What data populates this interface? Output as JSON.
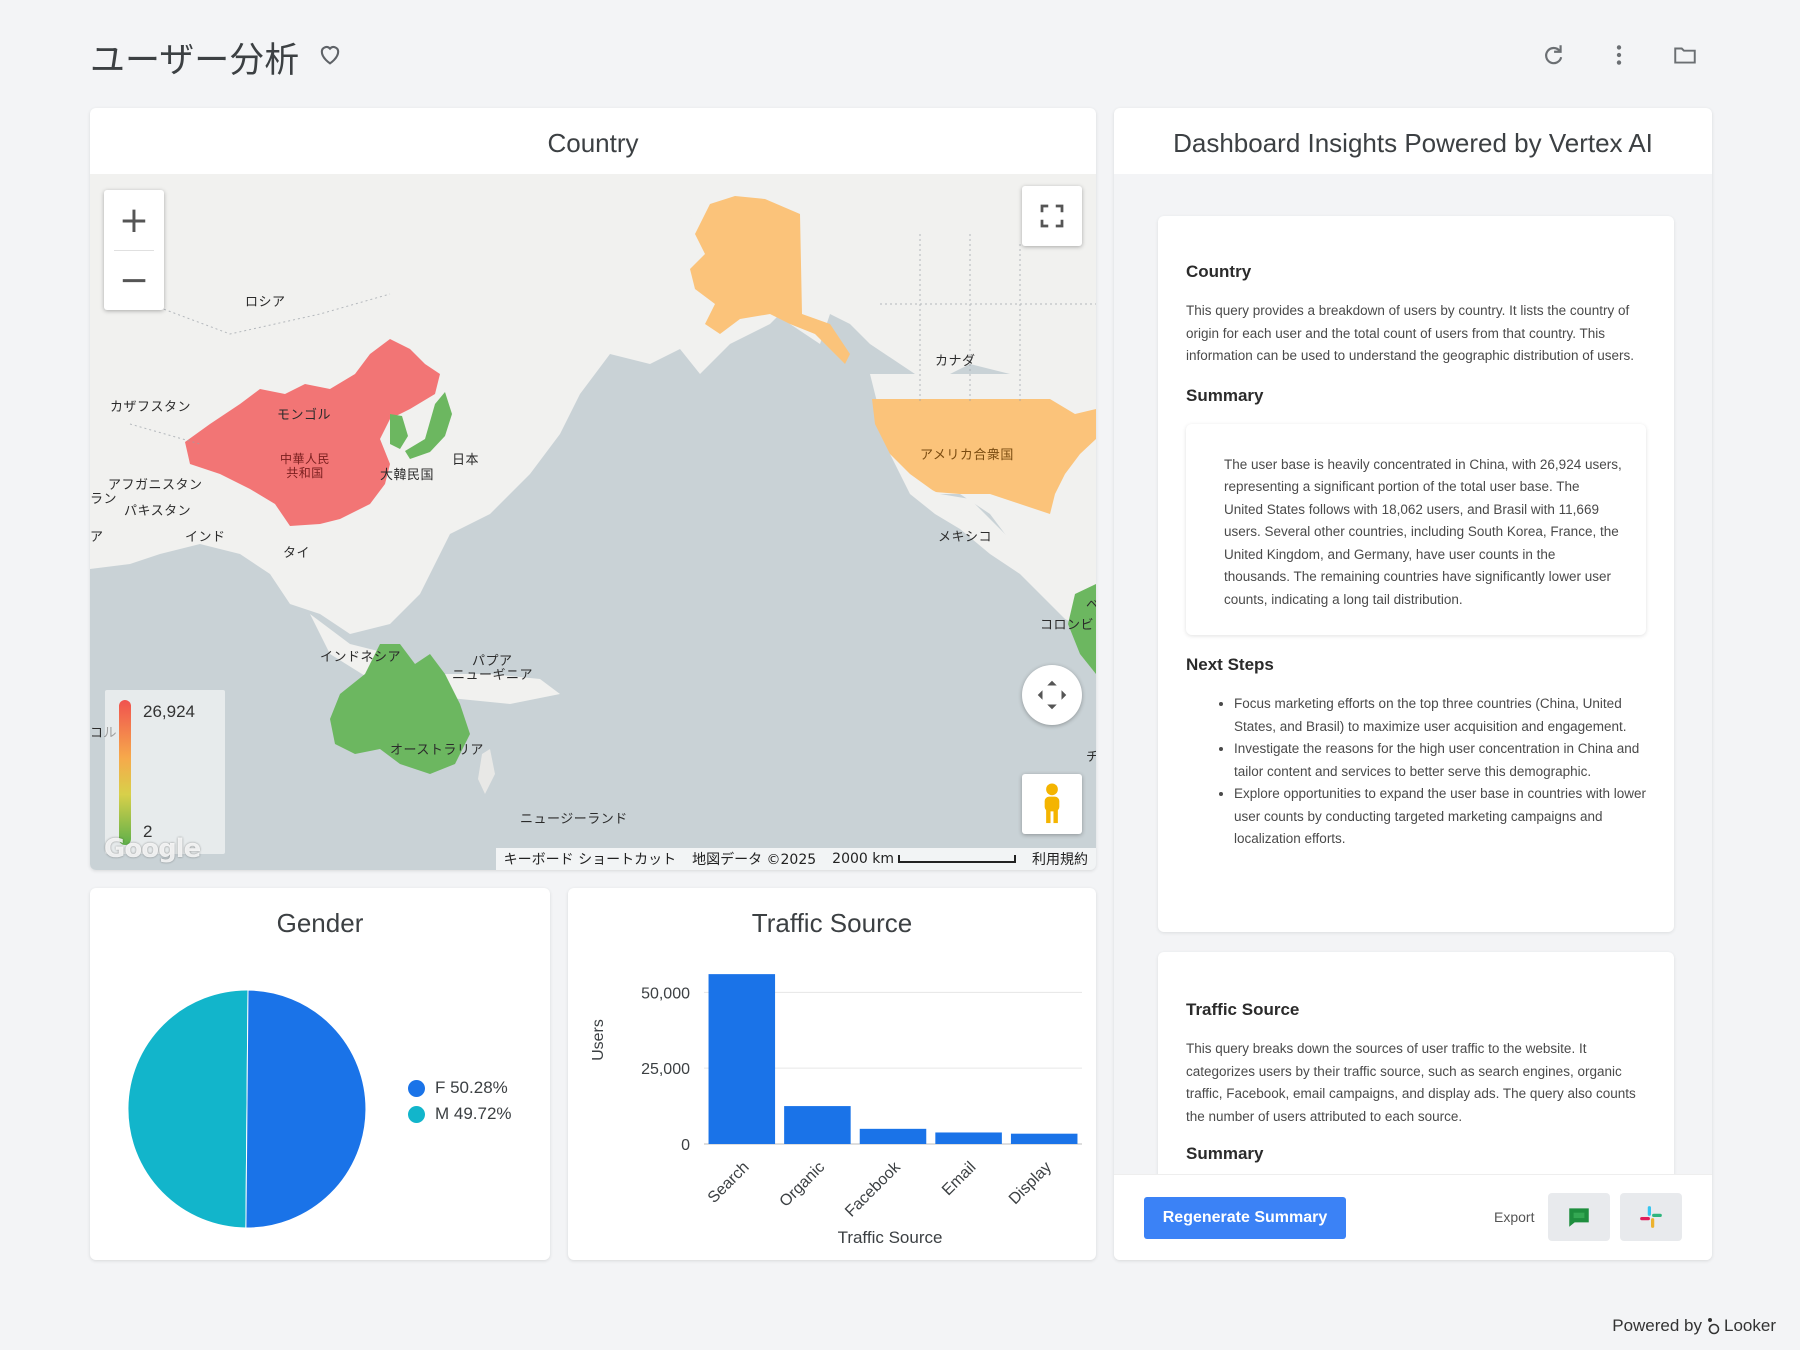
{
  "header": {
    "title": "ユーザー分析",
    "icons": [
      "heart-outline-icon",
      "refresh-icon",
      "more-vert-icon",
      "folder-icon"
    ]
  },
  "country_card": {
    "title": "Country",
    "legend_max": "26,924",
    "legend_min": "2",
    "colors": {
      "high": "#f27575",
      "mid": "#fbc37a",
      "low": "#6cb760"
    },
    "labels": {
      "russia": "ロシア",
      "kazakhstan": "カザフスタン",
      "mongolia": "モンゴル",
      "china": "中華人民共和国",
      "china_line1": "中華人民",
      "china_line2": "共和国",
      "korea": "大韓民国",
      "japan": "日本",
      "afghanistan": "アフガニスタン",
      "pakistan": "パキスタン",
      "india": "インド",
      "thailand": "タイ",
      "indonesia": "インドネシア",
      "png1": "パプア",
      "png2": "ニューギニア",
      "australia": "オーストラリア",
      "newzealand": "ニュージーランド",
      "canada": "カナダ",
      "usa": "アメリカ合衆国",
      "mexico": "メキシコ",
      "colombia": "コロンビ",
      "edge_ran": "ラン",
      "edge_a": "ア",
      "edge_ru": "コル",
      "edge_ve": "ベ",
      "edge_chi": "チ"
    },
    "google": "Google",
    "attribution": {
      "shortcuts": "キーボード ショートカット",
      "mapdata": "地図データ ©2025",
      "scale": "2000 km",
      "terms": "利用規約"
    }
  },
  "gender_card": {
    "title": "Gender",
    "legend": [
      {
        "label": "F 50.28%",
        "color": "#1a73e8"
      },
      {
        "label": "M 49.72%",
        "color": "#12b5cb"
      }
    ]
  },
  "chart_data": {
    "type": "bar",
    "title": "Traffic Source",
    "xlabel": "Traffic Source",
    "ylabel": "Users",
    "categories": [
      "Search",
      "Organic",
      "Facebook",
      "Email",
      "Display"
    ],
    "values": [
      56000,
      12500,
      5000,
      3800,
      3400
    ],
    "ylim": [
      0,
      60000
    ],
    "yticks": [
      "50,000",
      "25,000",
      "0"
    ],
    "color": "#1a73e8"
  },
  "insights": {
    "title": "Dashboard Insights Powered by Vertex AI",
    "country": {
      "heading": "Country",
      "description": "This query provides a breakdown of users by country. It lists the country of origin for each user and the total count of users from that country. This information can be used to understand the geographic distribution of users.",
      "summary_heading": "Summary",
      "summary": "The user base is heavily concentrated in China, with 26,924 users, representing a significant portion of the total user base. The United States follows with 18,062 users, and Brasil with 11,669 users. Several other countries, including South Korea, France, the United Kingdom, and Germany, have user counts in the thousands. The remaining countries have significantly lower user counts, indicating a long tail distribution.",
      "next_heading": "Next Steps",
      "next_steps": [
        "Focus marketing efforts on the top three countries (China, United States, and Brasil) to maximize user acquisition and engagement.",
        "Investigate the reasons for the high user concentration in China and tailor content and services to better serve this demographic.",
        "Explore opportunities to expand the user base in countries with lower user counts by conducting targeted marketing campaigns and localization efforts."
      ]
    },
    "traffic": {
      "heading": "Traffic Source",
      "description": "This query breaks down the sources of user traffic to the website. It categorizes users by their traffic source, such as search engines, organic traffic, Facebook, email campaigns, and display ads. The query also counts the number of users attributed to each source.",
      "summary_heading": "Summary"
    },
    "regenerate": "Regenerate Summary",
    "export": "Export"
  },
  "footer": {
    "powered_by": "Powered by",
    "brand": "Looker"
  }
}
